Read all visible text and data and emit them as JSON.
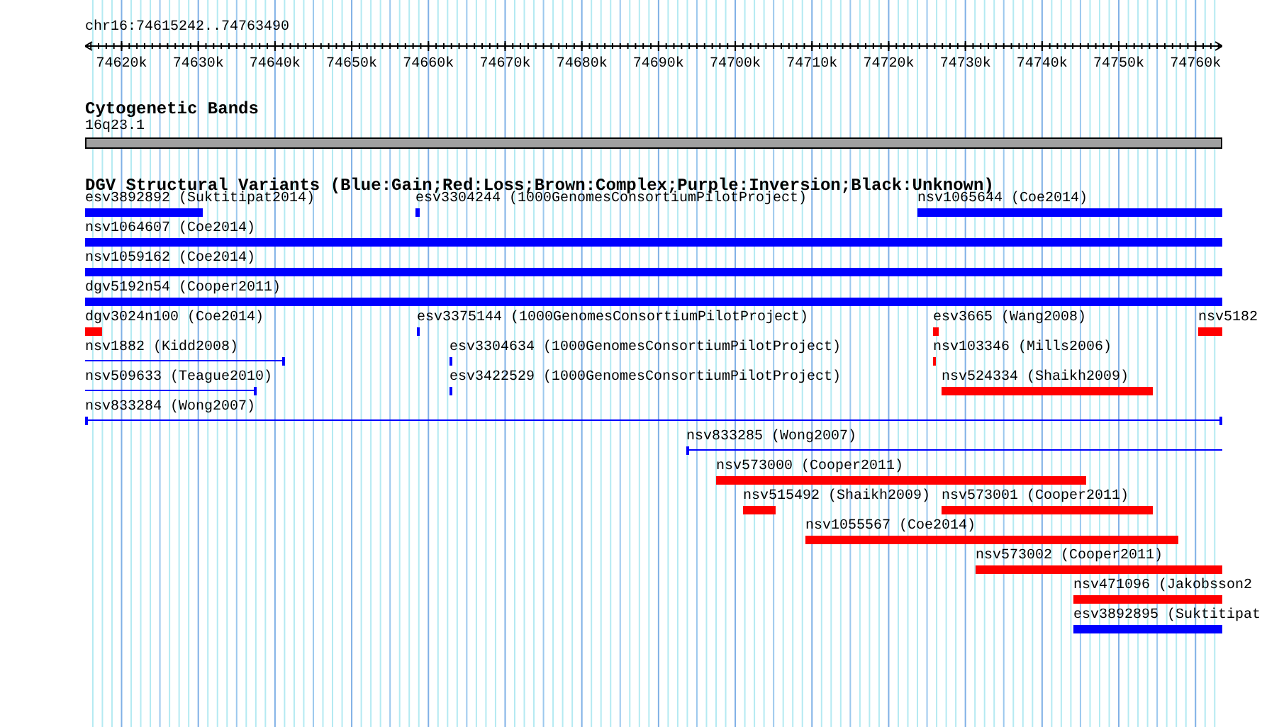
{
  "ruler": {
    "region": "chr16:74615242..74763490",
    "ticks": [
      "74620k",
      "74630k",
      "74640k",
      "74650k",
      "74660k",
      "74670k",
      "74680k",
      "74690k",
      "74700k",
      "74710k",
      "74720k",
      "74730k",
      "74740k",
      "74750k",
      "74760k"
    ]
  },
  "cytogenetic_bands": {
    "title": "Cytogenetic Bands",
    "band": "16q23.1"
  },
  "variants": {
    "title": "DGV Structural Variants (Blue:Gain;Red:Loss;Brown:Complex;Purple:Inversion;Black:Unknown)",
    "features": [
      {
        "label": "esv3892892 (Suktitipat2014)",
        "kind": "bar",
        "color": "#0000ff"
      },
      {
        "label": "esv3304244 (1000GenomesConsortiumPilotProject)",
        "kind": "bar",
        "color": "#0000ff"
      },
      {
        "label": "nsv1065644 (Coe2014)",
        "kind": "bar",
        "color": "#0000ff"
      },
      {
        "label": "nsv1064607 (Coe2014)",
        "kind": "bar",
        "color": "#0000ff"
      },
      {
        "label": "nsv1059162 (Coe2014)",
        "kind": "bar",
        "color": "#0000ff"
      },
      {
        "label": "dgv5192n54 (Cooper2011)",
        "kind": "bar",
        "color": "#0000ff"
      },
      {
        "label": "dgv3024n100 (Coe2014)",
        "kind": "bar",
        "color": "#ff0000"
      },
      {
        "label": "esv3375144 (1000GenomesConsortiumPilotProject)",
        "kind": "bar",
        "color": "#0000ff"
      },
      {
        "label": "esv3665 (Wang2008)",
        "kind": "bar",
        "color": "#ff0000"
      },
      {
        "label": "nsv5182",
        "kind": "bar",
        "color": "#ff0000"
      },
      {
        "label": "nsv1882 (Kidd2008)",
        "kind": "line",
        "color": "#0000ff"
      },
      {
        "label": "esv3304634 (1000GenomesConsortiumPilotProject)",
        "kind": "bar",
        "color": "#0000ff"
      },
      {
        "label": "nsv103346 (Mills2006)",
        "kind": "bar",
        "color": "#ff0000"
      },
      {
        "label": "nsv509633 (Teague2010)",
        "kind": "line",
        "color": "#0000ff"
      },
      {
        "label": "esv3422529 (1000GenomesConsortiumPilotProject)",
        "kind": "bar",
        "color": "#0000ff"
      },
      {
        "label": "nsv524334 (Shaikh2009)",
        "kind": "bar",
        "color": "#ff0000"
      },
      {
        "label": "nsv833284 (Wong2007)",
        "kind": "line",
        "color": "#0000ff"
      },
      {
        "label": "nsv833285 (Wong2007)",
        "kind": "line",
        "color": "#0000ff"
      },
      {
        "label": "nsv573000 (Cooper2011)",
        "kind": "bar",
        "color": "#ff0000"
      },
      {
        "label": "nsv515492 (Shaikh2009)",
        "kind": "bar",
        "color": "#ff0000"
      },
      {
        "label": "nsv573001 (Cooper2011)",
        "kind": "bar",
        "color": "#ff0000"
      },
      {
        "label": "nsv1055567 (Coe2014)",
        "kind": "bar",
        "color": "#ff0000"
      },
      {
        "label": "nsv573002 (Cooper2011)",
        "kind": "bar",
        "color": "#ff0000"
      },
      {
        "label": "nsv471096 (Jakobsson2",
        "kind": "bar",
        "color": "#ff0000"
      },
      {
        "label": "esv3892895 (Suktitipat",
        "kind": "bar",
        "color": "#0000ff"
      }
    ]
  }
}
